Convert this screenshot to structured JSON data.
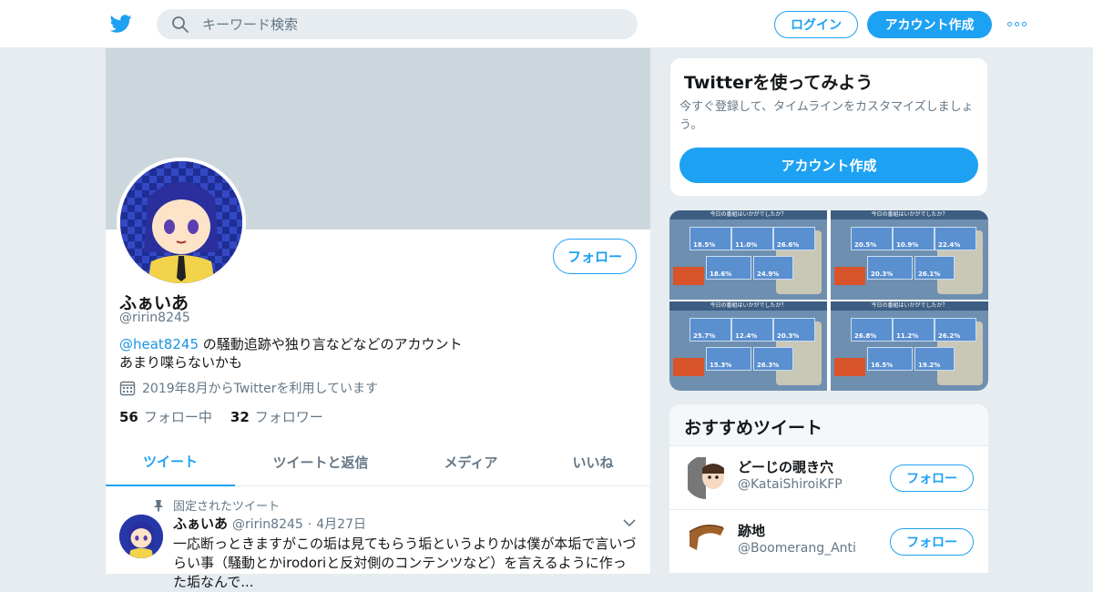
{
  "header": {
    "search_placeholder": "キーワード検索",
    "login_label": "ログイン",
    "signup_label": "アカウント作成"
  },
  "profile": {
    "name": "ふぁいあ",
    "handle": "@ririn8245",
    "follow_label": "フォロー",
    "bio_mention": "@heat8245",
    "bio_line1": " の騒動追跡や独り言などなどのアカウント",
    "bio_line2": "あまり喋らないかも",
    "joined": "2019年8月からTwitterを利用しています",
    "following_count": "56",
    "following_label": "フォロー中",
    "followers_count": "32",
    "followers_label": "フォロワー"
  },
  "tabs": [
    "ツイート",
    "ツイートと返信",
    "メディア",
    "いいね"
  ],
  "tweet": {
    "pinned_label": "固定されたツイート",
    "name": "ふぁいあ",
    "handle": "@ririn8245",
    "sep": "·",
    "date": "4月27日",
    "text": "一応断っときますがこの垢は見てもらう垢というよりかは僕が本垢で言いづらい事（騒動とかirodoriと反対側のコンテンツなど）を言えるように作った垢なんで..."
  },
  "side_signup": {
    "title": "Twitterを使ってみよう",
    "desc": "今すぐ登録して、タイムラインをカスタマイズしましょう。",
    "button": "アカウント作成"
  },
  "media": {
    "thumb_header": "今日の番組はいかがでしたか？",
    "thumbs": [
      [
        "18.5%",
        "11.0%",
        "26.6%",
        "18.6%",
        "24.9%"
      ],
      [
        "20.5%",
        "10.9%",
        "22.4%",
        "20.3%",
        "26.1%"
      ],
      [
        "25.7%",
        "12.4%",
        "20.3%",
        "15.3%",
        "26.3%"
      ],
      [
        "26.8%",
        "11.2%",
        "26.2%",
        "16.5%",
        "19.2%"
      ]
    ]
  },
  "recommend": {
    "title": "おすすめツイート",
    "follow_label": "フォロー",
    "items": [
      {
        "name": "どーじの覗き穴",
        "handle": "@KataiShiroiKFP"
      },
      {
        "name": "跡地",
        "handle": "@Boomerang_Anti"
      }
    ]
  },
  "colors": {
    "accent": "#1da1f2",
    "banner": "#ccd6dd",
    "avatar_bg": "#23319a"
  }
}
